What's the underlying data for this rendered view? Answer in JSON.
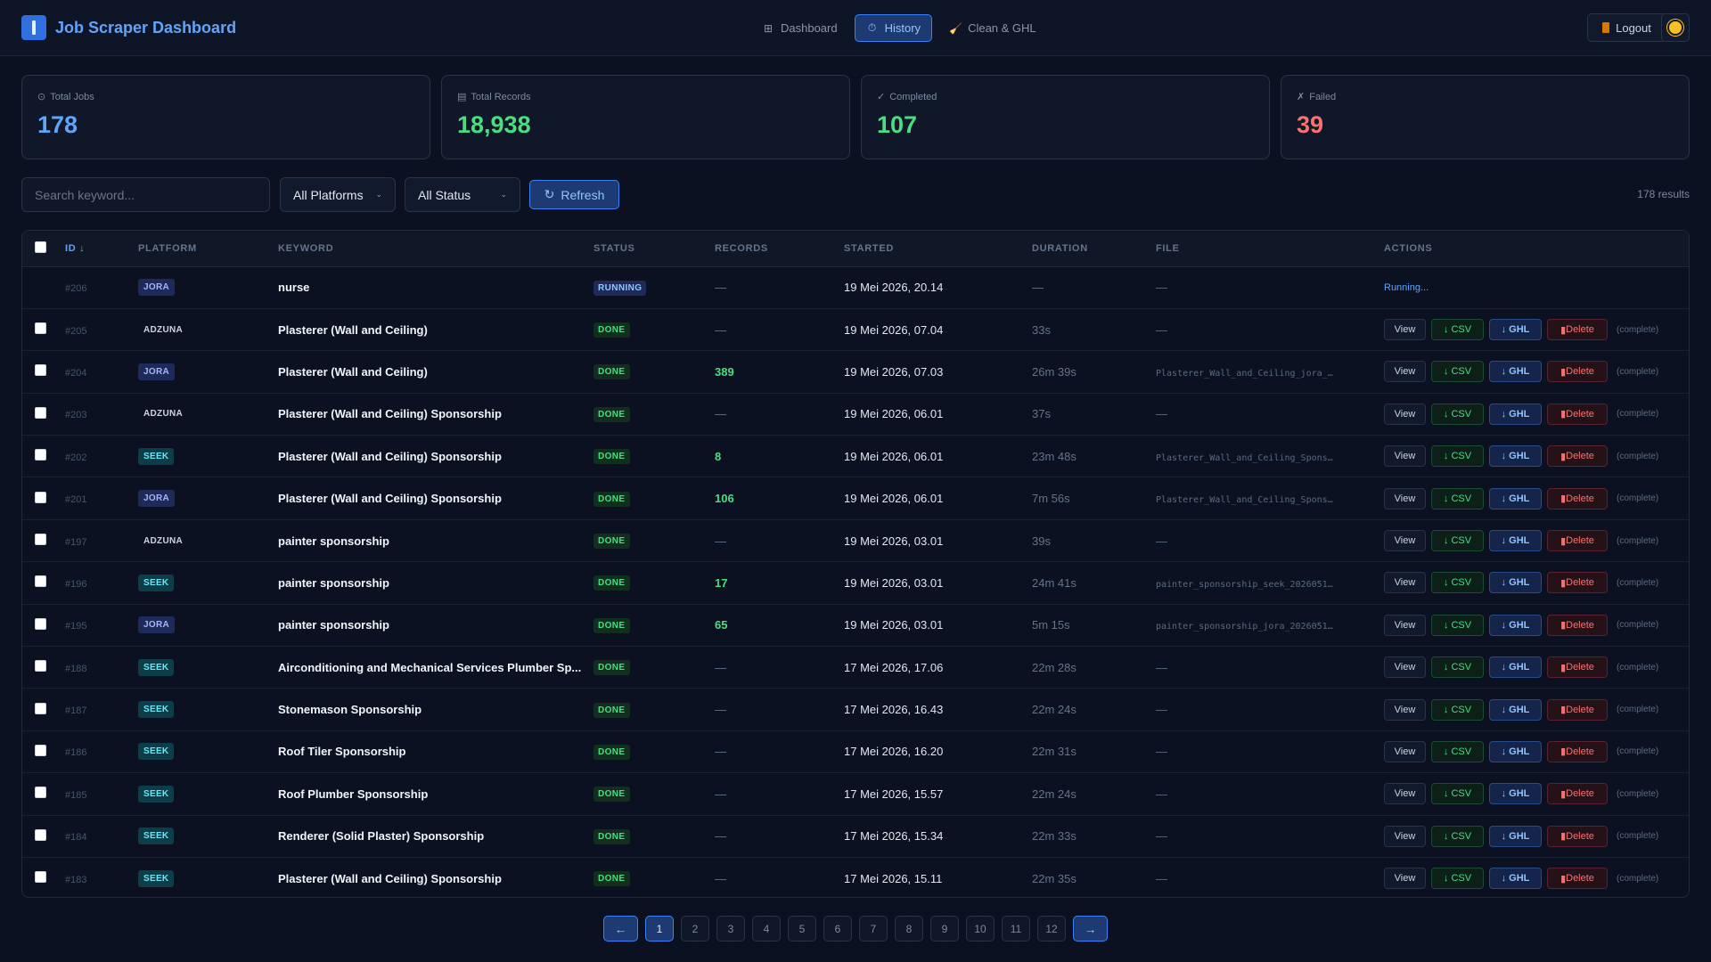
{
  "app": {
    "title": "Job Scraper Dashboard",
    "nav": [
      {
        "label": "Dashboard",
        "icon": "grid-icon",
        "glyph": "⊞",
        "active": false
      },
      {
        "label": "History",
        "icon": "clock-icon",
        "glyph": "⏱",
        "active": true
      },
      {
        "label": "Clean & GHL",
        "icon": "broom-icon",
        "glyph": "🧹",
        "active": false
      }
    ],
    "logout_label": "Logout"
  },
  "stats": [
    {
      "label": "Total Jobs",
      "glyph": "⊙",
      "value": "178",
      "color": "blue"
    },
    {
      "label": "Total Records",
      "glyph": "▤",
      "value": "18,938",
      "color": "green"
    },
    {
      "label": "Completed",
      "glyph": "✓",
      "value": "107",
      "color": "green"
    },
    {
      "label": "Failed",
      "glyph": "✗",
      "value": "39",
      "color": "red"
    }
  ],
  "filters": {
    "search_placeholder": "Search keyword...",
    "platform_select": "All Platforms",
    "status_select": "All Status",
    "refresh_label": "Refresh",
    "results_count": "178 results"
  },
  "table": {
    "columns": [
      "ID",
      "PLATFORM",
      "KEYWORD",
      "STATUS",
      "RECORDS",
      "STARTED",
      "DURATION",
      "FILE",
      "ACTIONS"
    ],
    "sort_glyph": "↓",
    "action_labels": {
      "view": "View",
      "csv": "↓ CSV",
      "ghl": "↓ GHL",
      "delete": "Delete",
      "complete": "(complete)"
    },
    "rows": [
      {
        "id": "#206",
        "platform": "JORA",
        "keyword": "nurse",
        "status": "RUNNING",
        "records": "—",
        "started": "19 Mei 2026, 20.14",
        "duration": "—",
        "file": "—",
        "running_text": "Running..."
      },
      {
        "id": "#205",
        "platform": "ADZUNA",
        "keyword": "Plasterer (Wall and Ceiling)",
        "status": "DONE",
        "records": "—",
        "started": "19 Mei 2026, 07.04",
        "duration": "33s",
        "file": "—"
      },
      {
        "id": "#204",
        "platform": "JORA",
        "keyword": "Plasterer (Wall and Ceiling)",
        "status": "DONE",
        "records": "389",
        "started": "19 Mei 2026, 07.03",
        "duration": "26m 39s",
        "file": "Plasterer_Wall_and_Ceiling_jora_…"
      },
      {
        "id": "#203",
        "platform": "ADZUNA",
        "keyword": "Plasterer (Wall and Ceiling) Sponsorship",
        "status": "DONE",
        "records": "—",
        "started": "19 Mei 2026, 06.01",
        "duration": "37s",
        "file": "—"
      },
      {
        "id": "#202",
        "platform": "SEEK",
        "keyword": "Plasterer (Wall and Ceiling) Sponsorship",
        "status": "DONE",
        "records": "8",
        "started": "19 Mei 2026, 06.01",
        "duration": "23m 48s",
        "file": "Plasterer_Wall_and_Ceiling_Spons…"
      },
      {
        "id": "#201",
        "platform": "JORA",
        "keyword": "Plasterer (Wall and Ceiling) Sponsorship",
        "status": "DONE",
        "records": "106",
        "started": "19 Mei 2026, 06.01",
        "duration": "7m 56s",
        "file": "Plasterer_Wall_and_Ceiling_Spons…"
      },
      {
        "id": "#197",
        "platform": "ADZUNA",
        "keyword": "painter sponsorship",
        "status": "DONE",
        "records": "—",
        "started": "19 Mei 2026, 03.01",
        "duration": "39s",
        "file": "—"
      },
      {
        "id": "#196",
        "platform": "SEEK",
        "keyword": "painter sponsorship",
        "status": "DONE",
        "records": "17",
        "started": "19 Mei 2026, 03.01",
        "duration": "24m 41s",
        "file": "painter_sponsorship_seek_2026051…"
      },
      {
        "id": "#195",
        "platform": "JORA",
        "keyword": "painter sponsorship",
        "status": "DONE",
        "records": "65",
        "started": "19 Mei 2026, 03.01",
        "duration": "5m 15s",
        "file": "painter_sponsorship_jora_2026051…"
      },
      {
        "id": "#188",
        "platform": "SEEK",
        "keyword": "Airconditioning and Mechanical Services Plumber Sp...",
        "status": "DONE",
        "records": "—",
        "started": "17 Mei 2026, 17.06",
        "duration": "22m 28s",
        "file": "—"
      },
      {
        "id": "#187",
        "platform": "SEEK",
        "keyword": "Stonemason Sponsorship",
        "status": "DONE",
        "records": "—",
        "started": "17 Mei 2026, 16.43",
        "duration": "22m 24s",
        "file": "—"
      },
      {
        "id": "#186",
        "platform": "SEEK",
        "keyword": "Roof Tiler Sponsorship",
        "status": "DONE",
        "records": "—",
        "started": "17 Mei 2026, 16.20",
        "duration": "22m 31s",
        "file": "—"
      },
      {
        "id": "#185",
        "platform": "SEEK",
        "keyword": "Roof Plumber Sponsorship",
        "status": "DONE",
        "records": "—",
        "started": "17 Mei 2026, 15.57",
        "duration": "22m 24s",
        "file": "—"
      },
      {
        "id": "#184",
        "platform": "SEEK",
        "keyword": "Renderer (Solid Plaster) Sponsorship",
        "status": "DONE",
        "records": "—",
        "started": "17 Mei 2026, 15.34",
        "duration": "22m 33s",
        "file": "—"
      },
      {
        "id": "#183",
        "platform": "SEEK",
        "keyword": "Plasterer (Wall and Ceiling) Sponsorship",
        "status": "DONE",
        "records": "—",
        "started": "17 Mei 2026, 15.11",
        "duration": "22m 35s",
        "file": "—"
      }
    ]
  },
  "pagination": {
    "prev": "←",
    "next": "→",
    "pages": [
      "1",
      "2",
      "3",
      "4",
      "5",
      "6",
      "7",
      "8",
      "9",
      "10",
      "11",
      "12"
    ],
    "current": "1"
  },
  "colors": {
    "background": "#0b1120",
    "accent": "#3b82f6",
    "success": "#4ade80",
    "danger": "#f87171"
  }
}
